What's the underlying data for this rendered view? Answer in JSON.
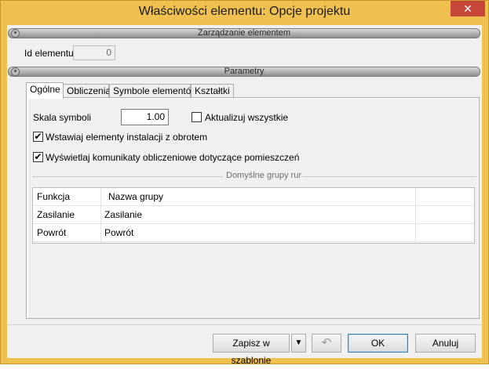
{
  "window": {
    "title": "Właściwości elementu: Opcje projektu",
    "close_glyph": "✕"
  },
  "sections": {
    "management": "Zarządzanie elementem",
    "parameters": "Parametry"
  },
  "element_id": {
    "label": "Id elementu",
    "value": "0"
  },
  "tabs": [
    {
      "label": "Ogólne",
      "active": true
    },
    {
      "label": "Obliczenia",
      "active": false
    },
    {
      "label": "Symbole elementów",
      "active": false
    },
    {
      "label": "Kształtki",
      "active": false
    }
  ],
  "general": {
    "symbol_scale_label": "Skala symboli",
    "symbol_scale_value": "1.00",
    "update_all_label": "Aktualizuj wszystkie",
    "update_all_checked": false,
    "insert_with_rotation_label": "Wstawiaj elementy instalacji z obrotem",
    "insert_with_rotation_checked": true,
    "show_messages_label": "Wyświetlaj komunikaty obliczeniowe dotyczące pomieszczeń",
    "show_messages_checked": true,
    "default_groups_title": "Domyślne grupy rur",
    "table": {
      "headers": [
        "Funkcja",
        "Nazwa grupy"
      ],
      "rows": [
        [
          "Zasilanie",
          "Zasilanie"
        ],
        [
          "Powrót",
          "Powrót"
        ]
      ]
    }
  },
  "footer": {
    "save_template": "Zapisz w szablonie",
    "ok": "OK",
    "cancel": "Anuluj"
  },
  "icons": {
    "check_glyph": "✔",
    "chevron_glyph": "▼",
    "undo_glyph": "↶",
    "collapse_glyph": "▾"
  }
}
